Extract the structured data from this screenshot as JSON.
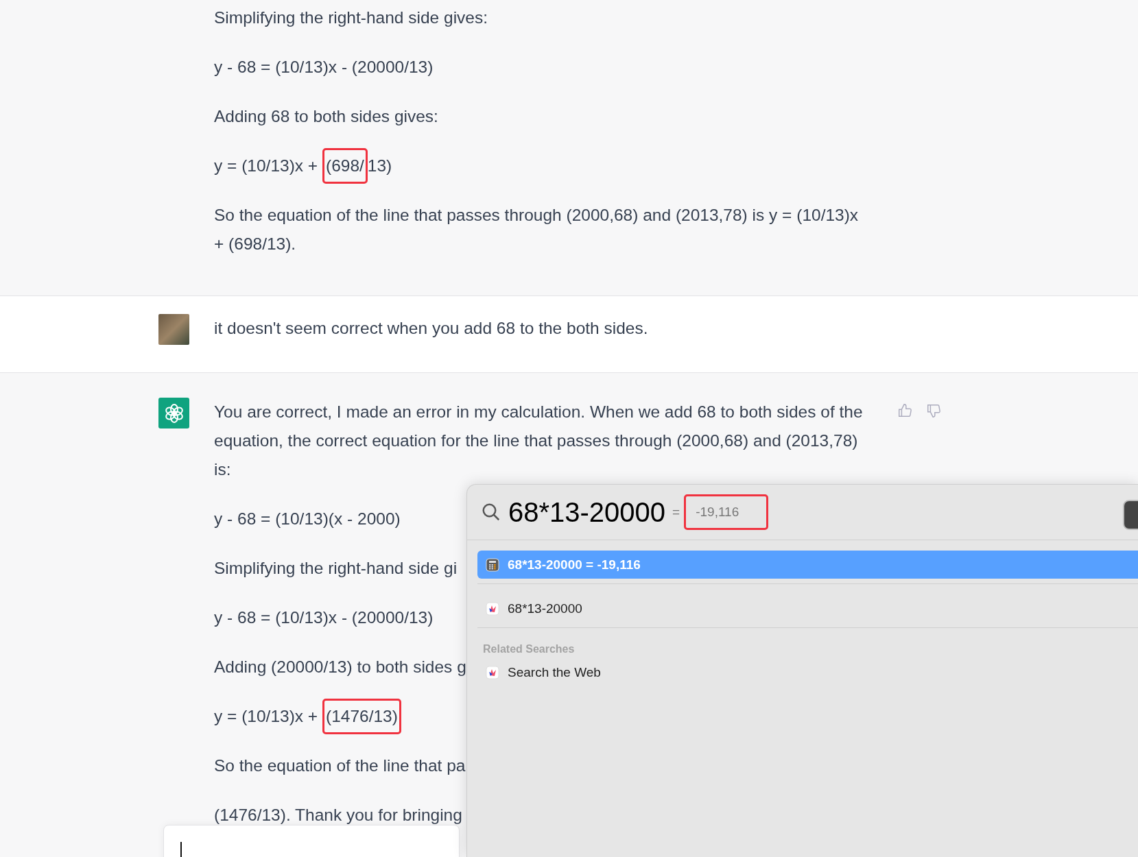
{
  "messages": [
    {
      "kind": "assistant",
      "avatar_shown": false,
      "feedback_shown": false,
      "paragraphs": [
        {
          "parts": [
            {
              "text": "Simplifying the right-hand side gives:",
              "marked": false
            }
          ]
        },
        {
          "parts": [
            {
              "text": "y - 68 = (10/13)x - (20000/13)",
              "marked": false
            }
          ]
        },
        {
          "parts": [
            {
              "text": "Adding 68 to both sides gives:",
              "marked": false
            }
          ]
        },
        {
          "parts": [
            {
              "text": "y = (10/13)x + ",
              "marked": false
            },
            {
              "text": "(698/",
              "marked": true
            },
            {
              "text": "13)",
              "marked": false
            }
          ]
        },
        {
          "parts": [
            {
              "text": "So the equation of the line that passes through (2000,68) and (2013,78) is y = (10/13)x + (698/13).",
              "marked": false
            }
          ]
        }
      ]
    },
    {
      "kind": "user",
      "avatar_shown": true,
      "feedback_shown": false,
      "paragraphs": [
        {
          "parts": [
            {
              "text": "it doesn't seem correct when you add 68 to the both sides.",
              "marked": false
            }
          ]
        }
      ]
    },
    {
      "kind": "assistant",
      "avatar_shown": true,
      "feedback_shown": true,
      "paragraphs": [
        {
          "parts": [
            {
              "text": "You are correct, I made an error in my calculation. When we add 68 to both sides of the equation, the correct equation for the line that passes through (2000,68) and (2013,78) is:",
              "marked": false
            }
          ]
        },
        {
          "parts": [
            {
              "text": "y - 68 = (10/13)(x - 2000)",
              "marked": false
            }
          ]
        },
        {
          "parts": [
            {
              "text": "Simplifying the right-hand side gi",
              "marked": false
            }
          ]
        },
        {
          "parts": [
            {
              "text": "y - 68 = (10/13)x - (20000/13)",
              "marked": false
            }
          ]
        },
        {
          "parts": [
            {
              "text": "Adding (20000/13) to both sides g",
              "marked": false
            }
          ]
        },
        {
          "parts": [
            {
              "text": "y = (10/13)x + ",
              "marked": false
            },
            {
              "text": "(1476/13)",
              "marked": true
            }
          ]
        },
        {
          "parts": [
            {
              "text": "So the equation of the line that pa",
              "marked": false
            }
          ]
        },
        {
          "parts": [
            {
              "text": "(1476/13). Thank you for bringing",
              "marked": false
            }
          ]
        }
      ]
    }
  ],
  "spotlight": {
    "query": "68*13-20000",
    "inline_result": [
      {
        "text": "=",
        "marked": false
      },
      {
        "text": "-19,116",
        "marked": true
      }
    ],
    "results": [
      {
        "kind": "calculator",
        "label": "68*13-20000 = -19,116",
        "selected": true
      },
      {
        "kind": "web",
        "label": "68*13-20000",
        "selected": false
      }
    ],
    "section_title": "Related Searches",
    "related": [
      {
        "kind": "web",
        "label": "Search the Web",
        "selected": false
      }
    ]
  }
}
